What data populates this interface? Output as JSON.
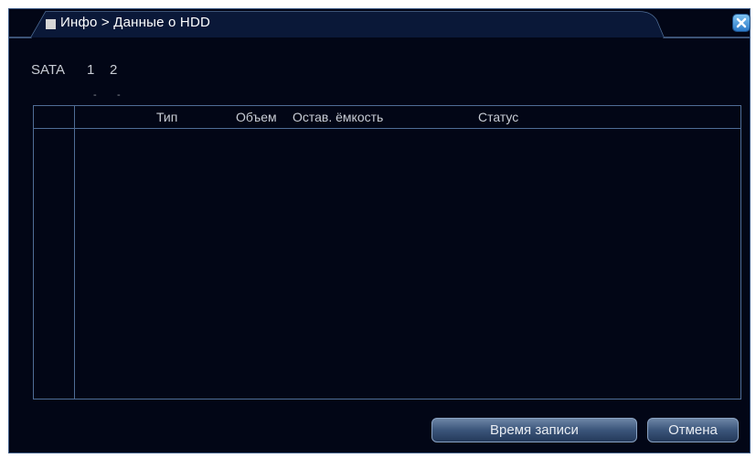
{
  "window": {
    "title": "Инфо > Данные о HDD"
  },
  "sata": {
    "label": "SATA",
    "ports": [
      "1",
      "2"
    ],
    "port_status": [
      "-",
      "-"
    ]
  },
  "table": {
    "columns": [
      "Тип",
      "Объем",
      "Остав. ёмкость",
      "Статус"
    ],
    "rows": []
  },
  "buttons": {
    "record_time": "Время записи",
    "cancel": "Отмена"
  },
  "colors": {
    "background": "#020616",
    "border": "#4f6d96",
    "text": "#c8ccd4"
  }
}
